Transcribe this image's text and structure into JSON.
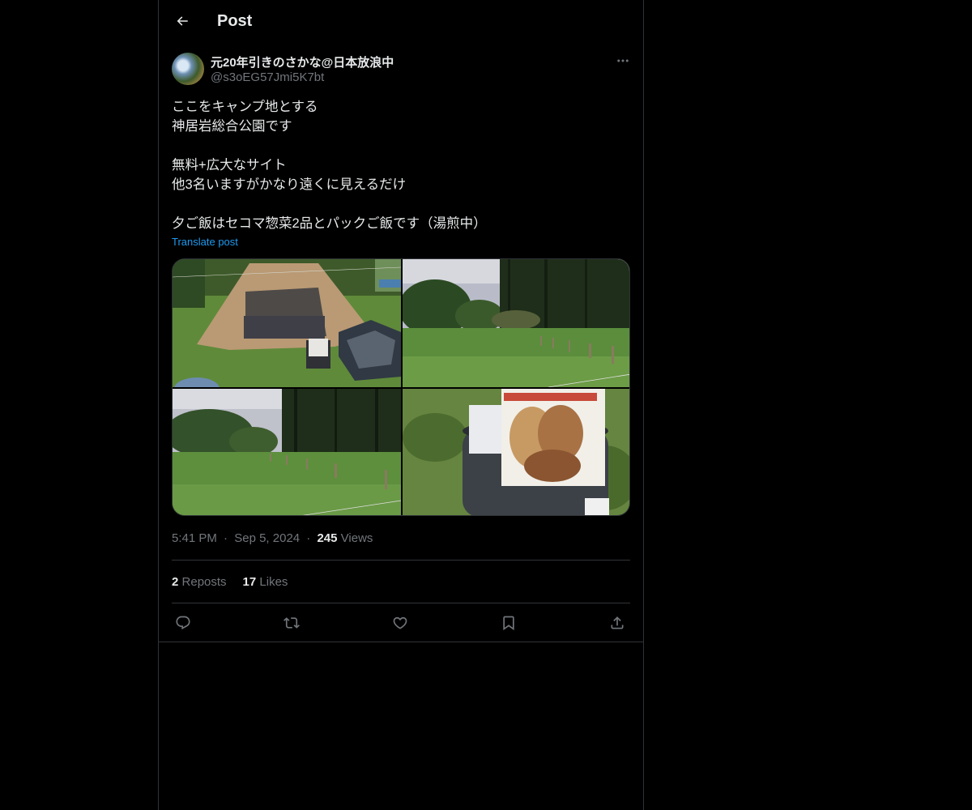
{
  "header": {
    "title": "Post",
    "back_icon": "arrow-left-icon"
  },
  "author": {
    "display_name": "元20年引きのさかな@日本放浪中",
    "handle": "@s3oEG57Jmi5K7bt"
  },
  "post": {
    "lines": [
      "ここをキャンプ地とする",
      "神居岩総合公園です",
      "",
      "無料+広大なサイト",
      "他3名いますがかなり遠くに見えるだけ",
      "",
      "夕ご飯はセコマ惣菜2品とパックご飯です（湯煎中）"
    ],
    "translate_label": "Translate post"
  },
  "media": {
    "photos": [
      "tent-on-grass",
      "field-with-trees",
      "campsite-fence-posts",
      "food-pouch-in-pot"
    ]
  },
  "meta": {
    "time": "5:41 PM",
    "date": "Sep 5, 2024",
    "views_count": "245",
    "views_label": "Views",
    "separator": "·"
  },
  "stats": {
    "reposts_count": "2",
    "reposts_label": "Reposts",
    "likes_count": "17",
    "likes_label": "Likes"
  },
  "actions": [
    "reply-icon",
    "repost-icon",
    "like-icon",
    "bookmark-icon",
    "share-icon"
  ],
  "colors": {
    "background": "#000000",
    "text": "#e7e9ea",
    "muted": "#71767b",
    "link": "#1d9bf0",
    "border": "#2f3336"
  }
}
